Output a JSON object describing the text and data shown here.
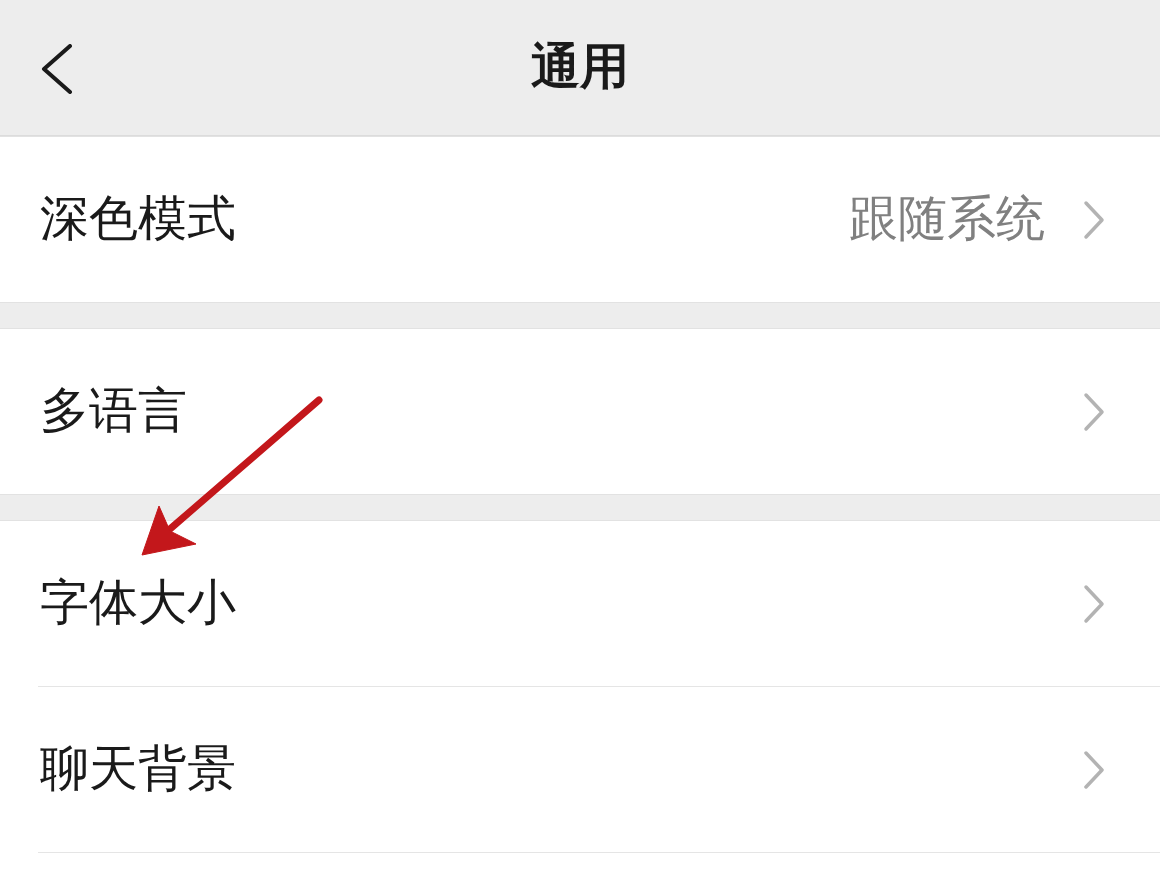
{
  "header": {
    "title": "通用"
  },
  "groups": [
    {
      "items": [
        {
          "label": "深色模式",
          "value": "跟随系统",
          "annotated": false
        }
      ]
    },
    {
      "items": [
        {
          "label": "多语言",
          "annotated": false
        }
      ]
    },
    {
      "items": [
        {
          "label": "字体大小",
          "annotated": true
        },
        {
          "label": "聊天背景",
          "annotated": false
        }
      ]
    }
  ]
}
